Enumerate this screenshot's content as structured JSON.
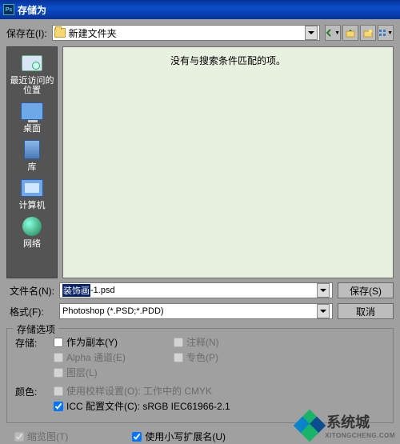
{
  "titlebar": {
    "title": "存储为",
    "icon": "Ps"
  },
  "top": {
    "save_in_label": "保存在(I):",
    "folder_name": "新建文件夹",
    "tool_back": "back-icon",
    "tool_up": "up-icon",
    "tool_newfolder": "new-folder-icon",
    "tool_views": "views-icon"
  },
  "places": {
    "recent": "最近访问的位置",
    "desktop": "桌面",
    "library": "库",
    "computer": "计算机",
    "network": "网络"
  },
  "listing": {
    "empty_text": "没有与搜索条件匹配的项。"
  },
  "file": {
    "name_label": "文件名(N):",
    "name_selected": "装饰画",
    "name_ext": "-1.psd",
    "format_label": "格式(F):",
    "format_value": "Photoshop (*.PSD;*.PDD)",
    "save_btn": "保存(S)",
    "cancel_btn": "取消"
  },
  "options": {
    "group_title": "存储选项",
    "save_label": "存储:",
    "as_copy": "作为副本(Y)",
    "annotations": "注释(N)",
    "alpha": "Alpha 通道(E)",
    "spot": "专色(P)",
    "layers": "图层(L)",
    "color_label": "颜色:",
    "proof": "使用校样设置(O): 工作中的 CMYK",
    "icc": "ICC 配置文件(C): sRGB IEC61966-2.1",
    "thumb": "缩览图(T)",
    "lowercase_ext": "使用小写扩展名(U)"
  },
  "watermark": {
    "text": "系统城",
    "sub": "XITONGCHENG.COM"
  }
}
